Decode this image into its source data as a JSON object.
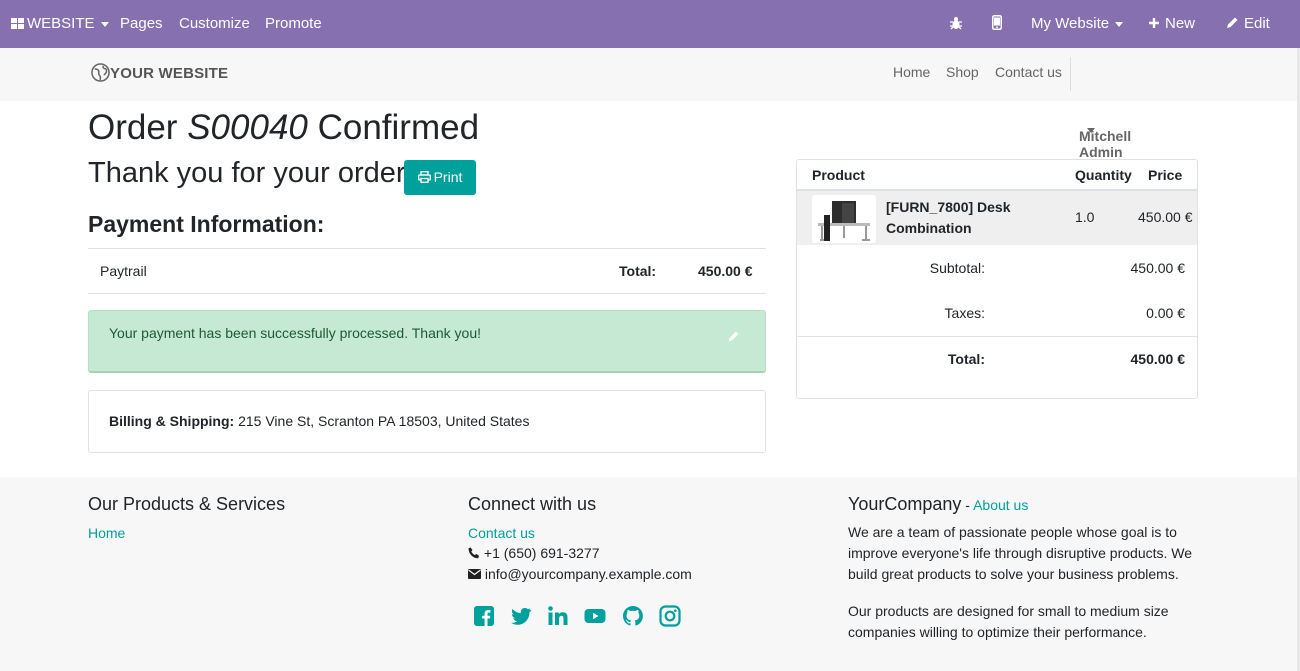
{
  "admin_bar": {
    "website_label": "WEBSITE",
    "pages": "Pages",
    "customize": "Customize",
    "promote": "Promote",
    "my_website": "My Website",
    "new": "New",
    "edit": "Edit",
    "icons": [
      "grid-icon",
      "bug-icon",
      "mobile-icon",
      "plus-icon",
      "pencil-icon"
    ]
  },
  "header": {
    "logo_text": "YOUR WEBSITE",
    "nav": [
      "Home",
      "Shop",
      "Contact us"
    ],
    "user": "Mitchell Admin"
  },
  "order": {
    "title_prefix": "Order ",
    "order_number": "S00040",
    "title_suffix": " Confirmed",
    "thanks": "Thank you for your order.",
    "print_label": "Print"
  },
  "payment": {
    "heading": "Payment Information:",
    "method": "Paytrail",
    "total_label": "Total:",
    "total_value": "450.00 €",
    "success_message": "Your payment has been successfully processed. Thank you!"
  },
  "billing": {
    "label": "Billing & Shipping:",
    "address": "215 Vine St, Scranton PA 18503, United States"
  },
  "cart": {
    "headers": {
      "product": "Product",
      "quantity": "Quantity",
      "price": "Price"
    },
    "lines": [
      {
        "name": "[FURN_7800] Desk Combination",
        "quantity": "1.0",
        "price": "450.00 €"
      }
    ],
    "subtotal_label": "Subtotal:",
    "subtotal_value": "450.00 €",
    "taxes_label": "Taxes:",
    "taxes_value": "0.00 €",
    "total_label": "Total:",
    "total_value": "450.00 €"
  },
  "footer": {
    "products_heading": "Our Products & Services",
    "products_link": "Home",
    "connect_heading": "Connect with us",
    "contact_link": "Contact us",
    "phone": "+1 (650) 691-3277",
    "email": "info@yourcompany.example.com",
    "social_icons": [
      "facebook-icon",
      "twitter-icon",
      "linkedin-icon",
      "youtube-icon",
      "github-icon",
      "instagram-icon"
    ],
    "company_name": "YourCompany",
    "company_sep": " - ",
    "about_link": "About us",
    "about_p1": "We are a team of passionate people whose goal is to improve everyone's life through disruptive products. We build great products to solve your business problems.",
    "about_p2": "Our products are designed for small to medium size companies willing to optimize their performance."
  },
  "colors": {
    "admin_bar": "#8670b0",
    "accent": "#00A09D",
    "success_bg": "#c6e9d3"
  }
}
